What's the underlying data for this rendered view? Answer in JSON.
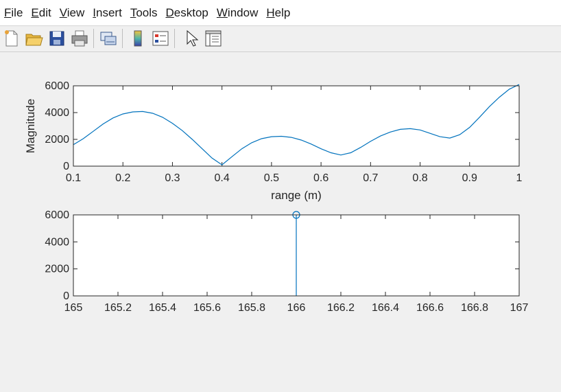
{
  "menu": [
    {
      "label": "File",
      "mnemonic": "F"
    },
    {
      "label": "Edit",
      "mnemonic": "E"
    },
    {
      "label": "View",
      "mnemonic": "V"
    },
    {
      "label": "Insert",
      "mnemonic": "I"
    },
    {
      "label": "Tools",
      "mnemonic": "T"
    },
    {
      "label": "Desktop",
      "mnemonic": "D"
    },
    {
      "label": "Window",
      "mnemonic": "W"
    },
    {
      "label": "Help",
      "mnemonic": "H"
    }
  ],
  "toolbar": [
    {
      "icon": "new-figure-icon"
    },
    {
      "icon": "open-file-icon"
    },
    {
      "icon": "save-icon"
    },
    {
      "icon": "print-icon"
    },
    {
      "icon": "link-plot-icon"
    },
    {
      "icon": "colorbar-icon"
    },
    {
      "icon": "legend-icon"
    },
    {
      "icon": "pointer-icon"
    },
    {
      "icon": "property-inspector-icon"
    }
  ],
  "chart_data": [
    {
      "type": "line",
      "xlabel": "range (m)",
      "ylabel": "Magnitude",
      "xlim": [
        0.1,
        1
      ],
      "ylim": [
        0,
        6000
      ],
      "xticks": [
        "0.1",
        "0.2",
        "0.3",
        "0.4",
        "0.5",
        "0.6",
        "0.7",
        "0.8",
        "0.9",
        "1"
      ],
      "yticks": [
        "0",
        "2000",
        "4000",
        "6000"
      ],
      "color": "#0072bd",
      "x": [
        0.1,
        0.12,
        0.14,
        0.16,
        0.18,
        0.2,
        0.22,
        0.24,
        0.26,
        0.28,
        0.3,
        0.32,
        0.34,
        0.36,
        0.38,
        0.4,
        0.42,
        0.44,
        0.46,
        0.48,
        0.5,
        0.52,
        0.54,
        0.56,
        0.58,
        0.6,
        0.62,
        0.64,
        0.66,
        0.68,
        0.7,
        0.72,
        0.74,
        0.76,
        0.78,
        0.8,
        0.82,
        0.84,
        0.86,
        0.88,
        0.9,
        0.92,
        0.94,
        0.96,
        0.98,
        1.0
      ],
      "y": [
        1600,
        2050,
        2600,
        3150,
        3600,
        3900,
        4050,
        4080,
        3950,
        3650,
        3200,
        2650,
        2000,
        1300,
        600,
        100,
        700,
        1300,
        1750,
        2050,
        2200,
        2230,
        2150,
        1950,
        1650,
        1300,
        1000,
        830,
        1000,
        1400,
        1850,
        2250,
        2550,
        2750,
        2800,
        2700,
        2450,
        2200,
        2100,
        2350,
        2900,
        3650,
        4450,
        5150,
        5750,
        6100
      ]
    },
    {
      "type": "stem",
      "xlim": [
        165,
        167
      ],
      "ylim": [
        0,
        6000
      ],
      "xticks": [
        "165",
        "165.2",
        "165.4",
        "165.6",
        "165.8",
        "166",
        "166.2",
        "166.4",
        "166.6",
        "166.8",
        "167"
      ],
      "yticks": [
        "0",
        "2000",
        "4000",
        "6000"
      ],
      "color": "#0072bd",
      "x": [
        166
      ],
      "y": [
        6000
      ]
    }
  ]
}
